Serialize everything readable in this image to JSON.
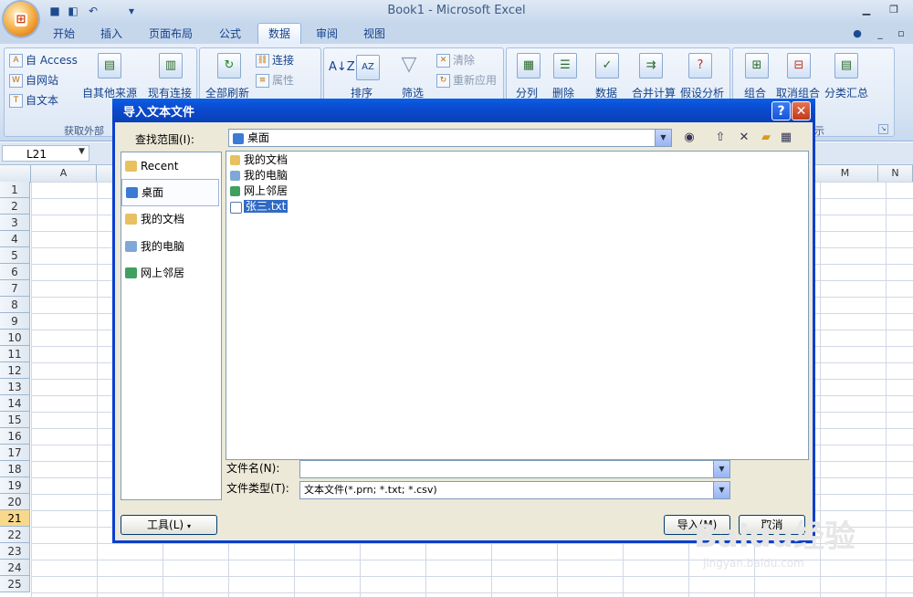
{
  "app": {
    "title": "Book1 - Microsoft Excel",
    "office_button": "⊞"
  },
  "tabs": [
    {
      "label": "开始"
    },
    {
      "label": "插入"
    },
    {
      "label": "页面布局"
    },
    {
      "label": "公式"
    },
    {
      "label": "数据"
    },
    {
      "label": "审阅"
    },
    {
      "label": "视图"
    }
  ],
  "ribbon": {
    "get_external": {
      "access": "自 Access",
      "web": "自网站",
      "text": "自文本",
      "other": "自其他来源",
      "existing": "现有连接",
      "group_label": "获取外部"
    },
    "connections": {
      "refresh_all": "全部刷新",
      "connections": "连接",
      "properties": "属性"
    },
    "sort_filter": {
      "sort": "排序",
      "filter": "筛选",
      "clear": "清除",
      "reapply": "重新应用"
    },
    "tools": {
      "split": "分列",
      "remove": "删除",
      "validate": "数据",
      "consolidate": "合并计算",
      "whatif": "假设分析"
    },
    "outline": {
      "group": "组合",
      "ungroup": "取消组合",
      "subtotal": "分类汇总",
      "group_label": "示"
    }
  },
  "formula_bar": {
    "namebox": "L21"
  },
  "grid": {
    "columns": [
      "A",
      "M",
      "N"
    ],
    "rows": [
      "1",
      "2",
      "3",
      "4",
      "5",
      "6",
      "7",
      "8",
      "9",
      "10",
      "11",
      "12",
      "13",
      "14",
      "15",
      "16",
      "17",
      "18",
      "19",
      "20",
      "21",
      "22",
      "23",
      "24",
      "25"
    ],
    "selected_row": "21"
  },
  "dialog": {
    "title": "导入文本文件",
    "help": "?",
    "close": "✕",
    "lookin_label": "查找范围(I):",
    "lookin_value": "桌面",
    "places": [
      {
        "label": "Recent"
      },
      {
        "label": "桌面"
      },
      {
        "label": "我的文档"
      },
      {
        "label": "我的电脑"
      },
      {
        "label": "网上邻居"
      }
    ],
    "files": [
      {
        "name": "我的文档"
      },
      {
        "name": "我的电脑"
      },
      {
        "name": "网上邻居"
      },
      {
        "name": "张三.txt"
      }
    ],
    "filename_label": "文件名(N):",
    "filename_value": "",
    "filetype_label": "文件类型(T):",
    "filetype_value": "文本文件(*.prn; *.txt; *.csv)",
    "tools_button": "工具(L)",
    "import_button": "导入(M)",
    "cancel_button": "取消"
  },
  "watermark": {
    "brand": "Baidu经验",
    "url": "jingyan.baidu.com"
  },
  "colors": {
    "dialog_border": "#0a3fcf",
    "selection": "#316ac5",
    "ribbon_text": "#15428b"
  }
}
